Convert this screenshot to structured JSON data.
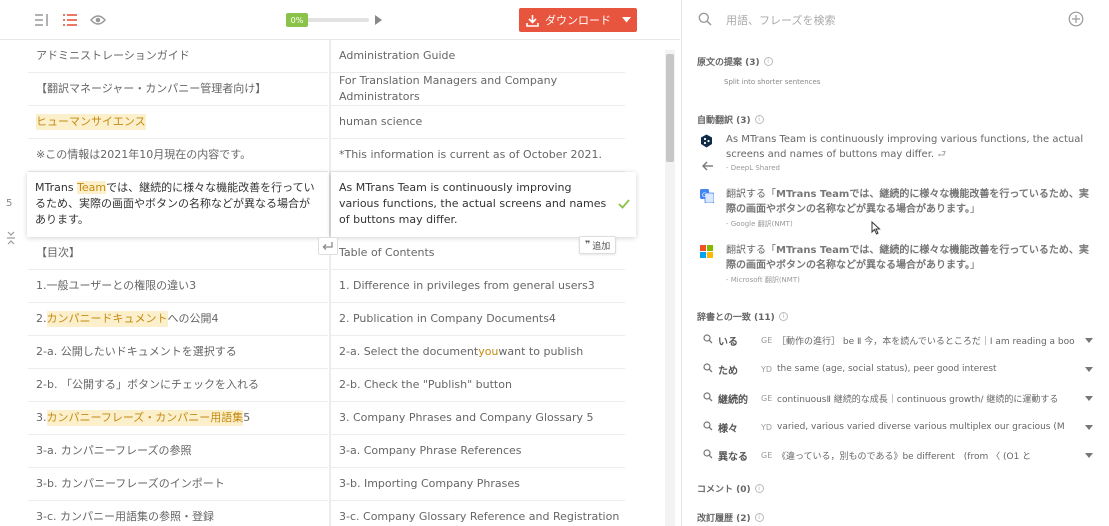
{
  "toolbar": {
    "progress_label": "0%",
    "progress_value": 0,
    "download_label": "ダウンロード"
  },
  "rows": [
    {
      "src": "アドミニストレーションガイド",
      "tgt": "Administration Guide"
    },
    {
      "src": "【翻訳マネージャー・カンパニー管理者向け】",
      "tgt": "For Translation Managers and Company Administrators"
    },
    {
      "src": "ヒューマンサイエンス",
      "tgt": "human science"
    },
    {
      "src": "※この情報は2021年10月現在の内容です。",
      "tgt": "*This information is current as of October 2021."
    },
    {
      "src_hl": "Team",
      "src_pre": "MTrans ",
      "src_post": "では、継続的に様々な機能改善を行っているため、実際の画面やボタンの名称などが異なる場合があります。",
      "tgt": "As MTrans Team is continuously improving various functions, the actual screens and names of buttons may differ.",
      "num": "5"
    },
    {
      "src": "【目次】",
      "tgt": "Table of Contents"
    },
    {
      "src": "1.一般ユーザーとの権限の違い3",
      "tgt": "1. Difference in privileges from general users3"
    },
    {
      "src_pre": "2.",
      "src_hl": "カンパニードキュメント",
      "src_post": "への公開4",
      "tgt": "2. Publication in Company Documents4"
    },
    {
      "src": "2-a. 公開したいドキュメントを選択する",
      "tgt_pre": "2-a. Select the document ",
      "tgt_hl": "you",
      "tgt_post": " want to publish"
    },
    {
      "src": "2-b. 「公開する」ボタンにチェックを入れる",
      "tgt": "2-b. Check the \"Publish\" button"
    },
    {
      "src_pre": "3.",
      "src_hl": "カンパニーフレーズ・カンパニー用語集",
      "src_post": "5",
      "tgt": "3. Company Phrases and Company Glossary 5"
    },
    {
      "src": "3-a. カンパニーフレーズの参照",
      "tgt": "3-a. Company Phrase References"
    },
    {
      "src": "3-b. カンパニーフレーズのインポート",
      "tgt": "3-b. Importing Company Phrases"
    },
    {
      "src": "3-c. カンパニー用語集の参照・登録",
      "tgt": "3-c. Company Glossary Reference and Registration"
    }
  ],
  "add_label": "追加",
  "panel": {
    "search_placeholder": "用語、フレーズを検索",
    "split_title": "原文の提案 (3)",
    "split_hint": "Split into shorter sentences",
    "mt_title": "自動翻訳 (3)",
    "mt": [
      {
        "text": "As MTrans Team is continuously improving various functions, the actual screens and names of buttons may differ.",
        "source": "- DeepL Shared"
      },
      {
        "prefix": "翻訳する「",
        "bold": "MTrans Teamでは、継続的に様々な機能改善を行っているため、実際の画面やボタンの名称などが異なる場合があります。",
        "suffix": "」",
        "source": "- Google 翻訳(NMT)"
      },
      {
        "prefix": "翻訳する「",
        "bold": "MTrans Teamでは、継続的に様々な機能改善を行っているため、実際の画面やボタンの名称などが異なる場合があります。",
        "suffix": "」",
        "source": "- Microsoft 翻訳(NMT)"
      }
    ],
    "dict_title": "辞書との一致 (11)",
    "dict": [
      {
        "term": "いる",
        "code": "GE",
        "def": "［動作の進行］ be Ⅱ 今，本を読んでいるところだ｜I am reading a book now"
      },
      {
        "term": "ため",
        "code": "YD",
        "def": "the same (age, social status), peer good interest"
      },
      {
        "term": "継続的",
        "code": "GE",
        "def": "continuousⅡ 継続的な成長｜continuous growth/ 継続的に運動する"
      },
      {
        "term": "様々",
        "code": "YD",
        "def": "varied, various varied diverse various multiplex our gracious (M"
      },
      {
        "term": "異なる",
        "code": "GE",
        "def": "《違っている，別ものである》be different　(from 〈 (O1 と"
      }
    ],
    "comment_title": "コメント (0)",
    "history_title": "改訂履歴 (2)"
  },
  "colors": {
    "accent": "#e8553e",
    "progress": "#8bc34a",
    "highlight": "#c48a10"
  }
}
